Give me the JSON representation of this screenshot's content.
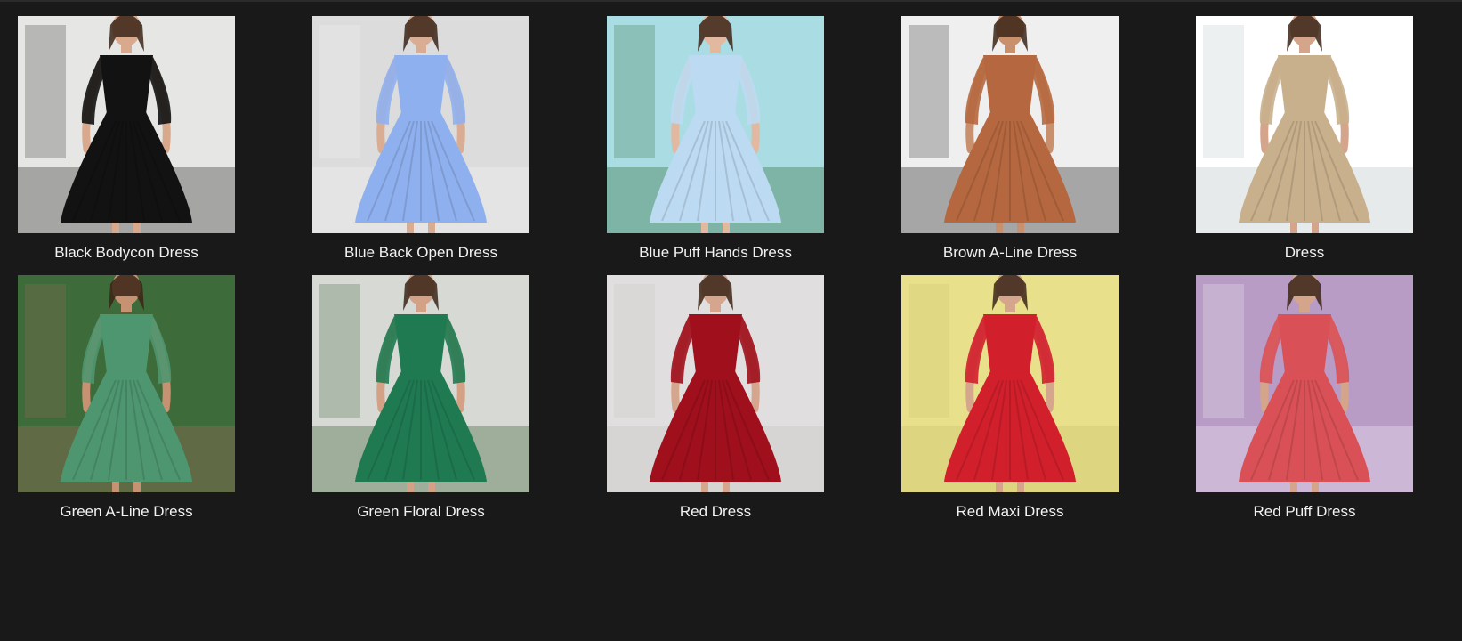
{
  "gallery": {
    "items": [
      {
        "label": "Black Bodycon Dress",
        "icon": "dress-photo",
        "bg": "#e6e6e4",
        "dress": "#121212",
        "skin": "#d8a98c",
        "accent": "#2a2a2a"
      },
      {
        "label": "Blue Back Open Dress",
        "icon": "dress-photo",
        "bg": "#dcdcdc",
        "dress": "#8fb0ee",
        "skin": "#d9ad93",
        "accent": "#f3f3f3"
      },
      {
        "label": "Blue Puff Hands Dress",
        "icon": "dress-photo",
        "bg": "#a9dce3",
        "dress": "#bcdaf2",
        "skin": "#e2b8a0",
        "accent": "#2f6b33"
      },
      {
        "label": "Brown A-Line Dress",
        "icon": "dress-photo",
        "bg": "#efefef",
        "dress": "#b5683f",
        "skin": "#c8906d",
        "accent": "#202020"
      },
      {
        "label": "Dress",
        "icon": "dress-photo",
        "bg": "#ffffff",
        "dress": "#c8b08c",
        "skin": "#d4a58a",
        "accent": "#b9c3c7"
      },
      {
        "label": "Green A-Line Dress",
        "icon": "dress-photo",
        "bg": "#3d6b3a",
        "dress": "#4e9670",
        "skin": "#c79271",
        "accent": "#a36b5c"
      },
      {
        "label": "Green Floral Dress",
        "icon": "dress-photo",
        "bg": "#d7d9d4",
        "dress": "#1f7a52",
        "skin": "#d2a186",
        "accent": "#355e2f"
      },
      {
        "label": "Red Dress",
        "icon": "dress-photo",
        "bg": "#e0dede",
        "dress": "#9f0f1c",
        "skin": "#d6a58d",
        "accent": "#c7c4c4"
      },
      {
        "label": "Red Maxi Dress",
        "icon": "dress-photo",
        "bg": "#e8e08a",
        "dress": "#d11f2c",
        "skin": "#d6a68c",
        "accent": "#c9bf6e"
      },
      {
        "label": "Red Puff Dress",
        "icon": "dress-photo",
        "bg": "#b89cc6",
        "dress": "#d95156",
        "skin": "#d4a58a",
        "accent": "#f2eef4"
      }
    ]
  }
}
